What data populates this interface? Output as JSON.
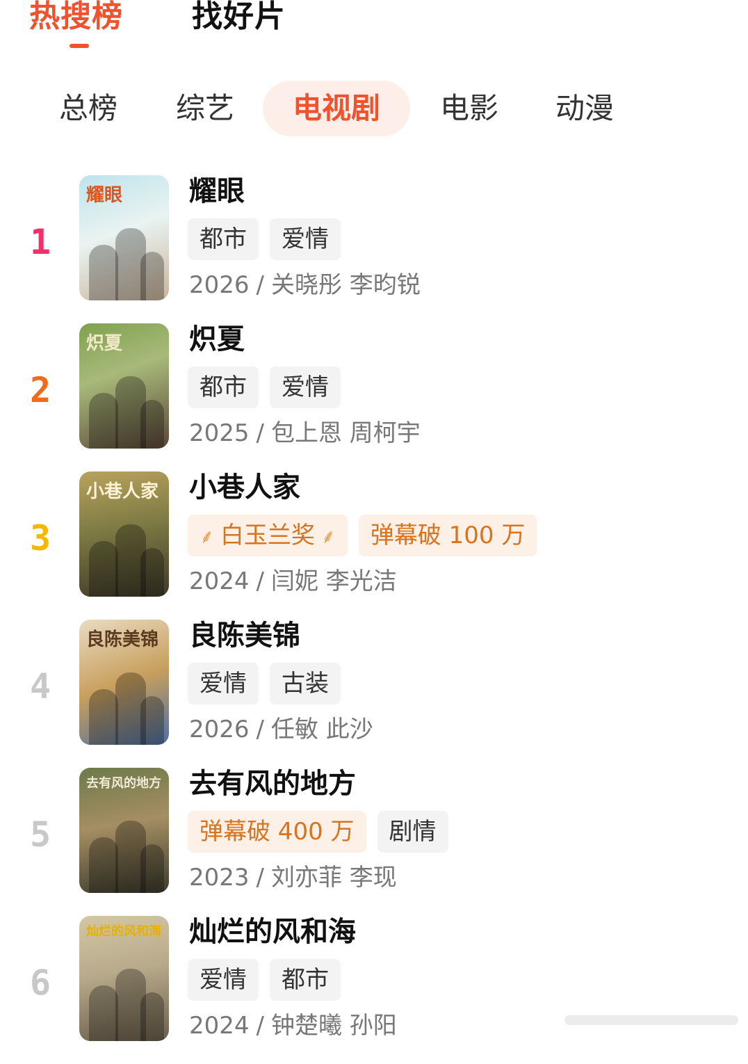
{
  "top_tabs": [
    {
      "label": "热搜榜",
      "active": true
    },
    {
      "label": "找好片",
      "active": false
    }
  ],
  "categories": [
    {
      "label": "总榜"
    },
    {
      "label": "综艺"
    },
    {
      "label": "电视剧",
      "active": true
    },
    {
      "label": "电影"
    },
    {
      "label": "动漫"
    }
  ],
  "colors": {
    "accent": "#f0522e",
    "rank_1": "#f0306a",
    "rank_2": "#f26a1b",
    "rank_3": "#f5b800",
    "rank_other": "#c8c8c8",
    "highlight_tag_text": "#d8731f",
    "highlight_tag_bg": "#fdf0e6"
  },
  "items": [
    {
      "rank": "1",
      "title": "耀眼",
      "tags": [
        {
          "text": "都市"
        },
        {
          "text": "爱情"
        }
      ],
      "year": "2026",
      "cast": "关晓彤 李昀锐",
      "poster_text": "耀眼"
    },
    {
      "rank": "2",
      "title": "炽夏",
      "tags": [
        {
          "text": "都市"
        },
        {
          "text": "爱情"
        }
      ],
      "year": "2025",
      "cast": "包上恩 周柯宇",
      "poster_text": "炽夏"
    },
    {
      "rank": "3",
      "title": "小巷人家",
      "tags": [
        {
          "text": "白玉兰奖",
          "highlight": true,
          "award": true
        },
        {
          "text": "弹幕破 100 万",
          "highlight": true
        }
      ],
      "year": "2024",
      "cast": "闫妮 李光洁",
      "poster_text": "小巷人家"
    },
    {
      "rank": "4",
      "title": "良陈美锦",
      "tags": [
        {
          "text": "爱情"
        },
        {
          "text": "古装"
        }
      ],
      "year": "2026",
      "cast": "任敏 此沙",
      "poster_text": "良陈美锦"
    },
    {
      "rank": "5",
      "title": "去有风的地方",
      "tags": [
        {
          "text": "弹幕破 400 万",
          "highlight": true
        },
        {
          "text": "剧情"
        }
      ],
      "year": "2023",
      "cast": "刘亦菲 李现",
      "poster_text": "去有风的地方"
    },
    {
      "rank": "6",
      "title": "灿烂的风和海",
      "tags": [
        {
          "text": "爱情"
        },
        {
          "text": "都市"
        }
      ],
      "year": "2024",
      "cast": "钟楚曦 孙阳",
      "poster_text": "灿烂的风和海"
    }
  ],
  "meta_separator": "/"
}
